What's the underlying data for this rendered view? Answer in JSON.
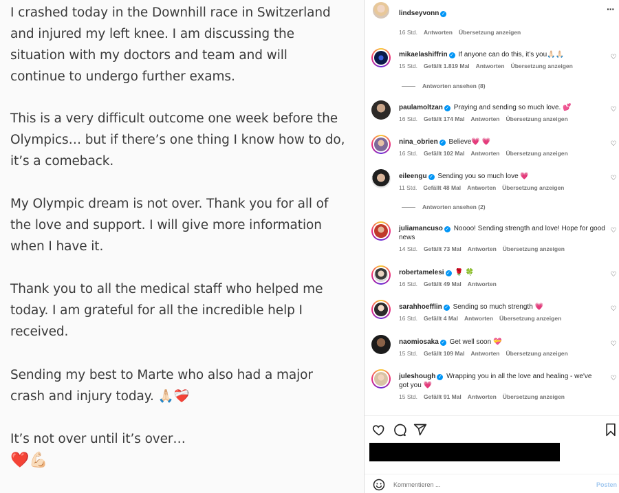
{
  "post": {
    "paragraphs": [
      [
        "I crashed today in the Downhill race in Switzerland",
        "and injured my left knee. I am discussing the",
        "situation with my doctors and team and will",
        "continue to undergo further exams."
      ],
      [
        "This is a very difficult outcome one week before the",
        "Olympics… but if there’s one thing I know how to do,",
        "it’s a comeback."
      ],
      [
        "My Olympic dream is not over. Thank you for all of",
        "the love and support. I will give more information",
        "when I have it."
      ],
      [
        "Thank you to all the medical staff who helped me",
        "today. I am grateful for all the incredible help I",
        "received."
      ],
      [
        "Sending my best to Marte who also had a major",
        "crash and injury today. 🙏🏻❤️‍🩹"
      ],
      [
        "It’s not over until it’s over…",
        "❤️💪🏻"
      ]
    ]
  },
  "header": {
    "username": "lindseyvonn",
    "more": "···"
  },
  "top_meta": {
    "time": "16 Std.",
    "reply": "Antworten",
    "translate": "Übersetzung anzeigen"
  },
  "comments": [
    {
      "user": "mikaelashiffrin",
      "text": "If anyone can do this, it’s you🙏🏻🙏🏻",
      "time": "15 Std.",
      "likes": "Gefällt 1.819 Mal",
      "reply": "Antworten",
      "translate": "Übersetzung anzeigen",
      "view_replies": "Antworten ansehen (8)"
    },
    {
      "user": "paulamoltzan",
      "text": "Praying and sending so much love. 💕",
      "time": "16 Std.",
      "likes": "Gefällt 174 Mal",
      "reply": "Antworten",
      "translate": "Übersetzung anzeigen"
    },
    {
      "user": "nina_obrien",
      "text": "Believe💗 💗",
      "time": "16 Std.",
      "likes": "Gefällt 102 Mal",
      "reply": "Antworten",
      "translate": "Übersetzung anzeigen"
    },
    {
      "user": "eileengu",
      "text": "Sending you so much love 💗",
      "time": "11 Std.",
      "likes": "Gefällt 48 Mal",
      "reply": "Antworten",
      "translate": "Übersetzung anzeigen",
      "view_replies": "Antworten ansehen (2)"
    },
    {
      "user": "juliamancuso",
      "text": "Noooo! Sending strength and love! Hope for good news",
      "time": "14 Std.",
      "likes": "Gefällt 73 Mal",
      "reply": "Antworten",
      "translate": "Übersetzung anzeigen"
    },
    {
      "user": "robertamelesi",
      "text": "🌹 🍀",
      "time": "16 Std.",
      "likes": "Gefällt 49 Mal",
      "reply": "Antworten",
      "translate": ""
    },
    {
      "user": "sarahhoefflin",
      "text": "Sending so much strength 💗",
      "time": "16 Std.",
      "likes": "Gefällt 4 Mal",
      "reply": "Antworten",
      "translate": "Übersetzung anzeigen"
    },
    {
      "user": "naomiosaka",
      "text": "Get well soon 💝",
      "time": "15 Std.",
      "likes": "Gefällt 109 Mal",
      "reply": "Antworten",
      "translate": "Übersetzung anzeigen"
    },
    {
      "user": "juleshough",
      "text": "Wrapping you in all the love and healing - we've got you 💗",
      "time": "15 Std.",
      "likes": "Gefällt 91 Mal",
      "reply": "Antworten",
      "translate": "Übersetzung anzeigen"
    }
  ],
  "composer": {
    "placeholder": "Kommentieren ...",
    "post": "Posten"
  },
  "colors": {
    "verified": "#0095f6",
    "muted": "#737373",
    "post_button": "#a3c9f0"
  }
}
